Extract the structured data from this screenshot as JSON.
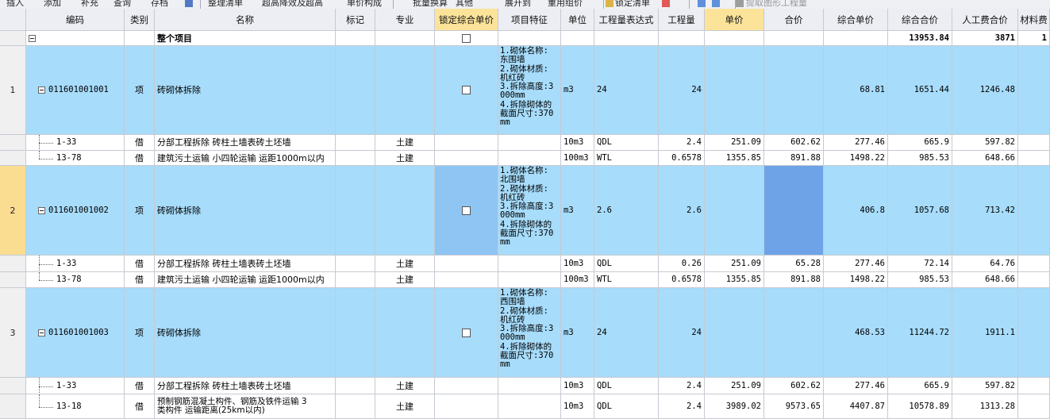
{
  "toolbar": {
    "items": [
      "插入",
      "添加",
      "补充",
      "查询",
      "存档",
      "整理清单",
      "超高降效及超高",
      "单价构成",
      "批量换算",
      "其他",
      "展开到",
      "重用组价",
      "锁定清单",
      "提取图形工程量"
    ]
  },
  "columns": [
    "编码",
    "类别",
    "名称",
    "标记",
    "专业",
    "锁定综合单价",
    "项目特征",
    "单位",
    "工程量表达式",
    "工程量",
    "单价",
    "合价",
    "综合单价",
    "综合合价",
    "人工费合价",
    "材料费"
  ],
  "total_row": {
    "name": "整个项目",
    "综合合价": "13953.84",
    "人工费合价": "3871",
    "材料费": "1"
  },
  "items": [
    {
      "no": "1",
      "code": "011601001001",
      "type": "项",
      "name": "砖砌体拆除",
      "feature": "1.砌体名称:\n东围墙\n2.砌体材质:\n机红砖\n3.拆除高度:3\n000mm\n4.拆除砌体的\n截面尺寸:370\nmm",
      "unit": "m3",
      "expr": "24",
      "qty": "24",
      "price": "",
      "total": "",
      "comp_price": "68.81",
      "comp_total": "1651.44",
      "labor": "1246.48",
      "subs": [
        {
          "code": "1-33",
          "type": "借",
          "name": "分部工程拆除 砖柱土墙表砖土坯墙",
          "spec": "土建",
          "unit": "10m3",
          "expr": "QDL",
          "qty": "2.4",
          "price": "251.09",
          "total": "602.62",
          "comp_price": "277.46",
          "comp_total": "665.9",
          "labor": "597.82"
        },
        {
          "code": "13-78",
          "type": "借",
          "name": "建筑污土运输 小四轮运输 运距1000m以内",
          "spec": "土建",
          "unit": "100m3",
          "expr": "WTL",
          "qty": "0.6578",
          "price": "1355.85",
          "total": "891.88",
          "comp_price": "1498.22",
          "comp_total": "985.53",
          "labor": "648.66"
        }
      ]
    },
    {
      "no": "2",
      "code": "011601001002",
      "type": "项",
      "name": "砖砌体拆除",
      "feature": "1.砌体名称:\n北围墙\n2.砌体材质:\n机红砖\n3.拆除高度:3\n000mm\n4.拆除砌体的\n截面尺寸:370\nmm",
      "unit": "m3",
      "expr": "2.6",
      "qty": "2.6",
      "price": "",
      "total": "",
      "comp_price": "406.8",
      "comp_total": "1057.68",
      "labor": "713.42",
      "subs": [
        {
          "code": "1-33",
          "type": "借",
          "name": "分部工程拆除 砖柱土墙表砖土坯墙",
          "spec": "土建",
          "unit": "10m3",
          "expr": "QDL",
          "qty": "0.26",
          "price": "251.09",
          "total": "65.28",
          "comp_price": "277.46",
          "comp_total": "72.14",
          "labor": "64.76"
        },
        {
          "code": "13-78",
          "type": "借",
          "name": "建筑污土运输 小四轮运输 运距1000m以内",
          "spec": "土建",
          "unit": "100m3",
          "expr": "WTL",
          "qty": "0.6578",
          "price": "1355.85",
          "total": "891.88",
          "comp_price": "1498.22",
          "comp_total": "985.53",
          "labor": "648.66"
        }
      ]
    },
    {
      "no": "3",
      "code": "011601001003",
      "type": "项",
      "name": "砖砌体拆除",
      "feature": "1.砌体名称:\n西围墙\n2.砌体材质:\n机红砖\n3.拆除高度:3\n000mm\n4.拆除砌体的\n截面尺寸:370\nmm",
      "unit": "m3",
      "expr": "24",
      "qty": "24",
      "price": "",
      "total": "",
      "comp_price": "468.53",
      "comp_total": "11244.72",
      "labor": "1911.1",
      "subs": [
        {
          "code": "1-33",
          "type": "借",
          "name": "分部工程拆除 砖柱土墙表砖土坯墙",
          "spec": "土建",
          "unit": "10m3",
          "expr": "QDL",
          "qty": "2.4",
          "price": "251.09",
          "total": "602.62",
          "comp_price": "277.46",
          "comp_total": "665.9",
          "labor": "597.82"
        },
        {
          "code": "13-18",
          "type": "借",
          "name": "预制钢筋混凝土构件、钢筋及铁件运输 3\n类构件 运输距离(25km以内)",
          "spec": "土建",
          "unit": "10m3",
          "expr": "QDL",
          "qty": "2.4",
          "price": "3989.02",
          "total": "9573.65",
          "comp_price": "4407.87",
          "comp_total": "10578.89",
          "labor": "1313.28"
        }
      ]
    }
  ]
}
